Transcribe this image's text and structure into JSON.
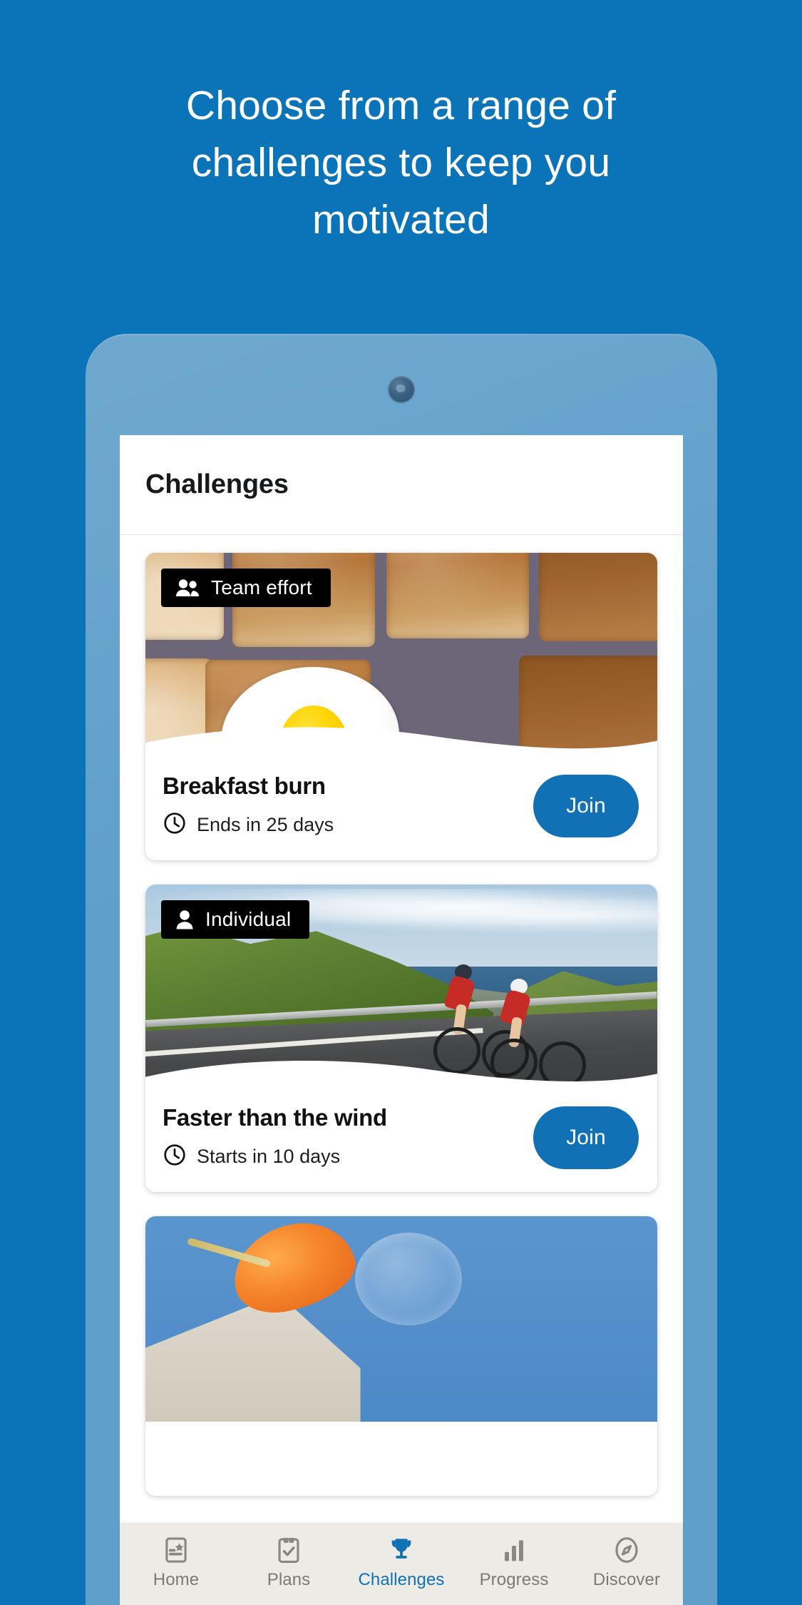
{
  "colors": {
    "background": "#0b73b8",
    "phone_frame": "#5f9fca",
    "accent": "#1271b5",
    "badge_bg": "#000000",
    "nav_bg": "#ecebe6",
    "nav_inactive": "#7b7a76"
  },
  "headline": "Choose from a range of challenges to keep you motivated",
  "app": {
    "header": {
      "title": "Challenges"
    },
    "cards": [
      {
        "badge": {
          "label": "Team effort",
          "icon": "group-icon"
        },
        "title": "Breakfast burn",
        "meta": {
          "icon": "clock-icon",
          "label": "Ends in 25 days"
        },
        "action": {
          "label": "Join"
        },
        "image_alt": "toast-slices-with-fried-egg"
      },
      {
        "badge": {
          "label": "Individual",
          "icon": "person-icon"
        },
        "title": "Faster than the wind",
        "meta": {
          "icon": "clock-icon",
          "label": "Starts in 10 days"
        },
        "action": {
          "label": "Join"
        },
        "image_alt": "two-cyclists-on-coastal-road"
      },
      {
        "image_alt": "strawberry-and-glass-against-blue-sky"
      }
    ],
    "bottom_nav": [
      {
        "label": "Home",
        "icon": "card-star-icon",
        "active": false
      },
      {
        "label": "Plans",
        "icon": "clipboard-check-icon",
        "active": false
      },
      {
        "label": "Challenges",
        "icon": "trophy-icon",
        "active": true
      },
      {
        "label": "Progress",
        "icon": "bar-chart-icon",
        "active": false
      },
      {
        "label": "Discover",
        "icon": "compass-icon",
        "active": false
      }
    ]
  }
}
